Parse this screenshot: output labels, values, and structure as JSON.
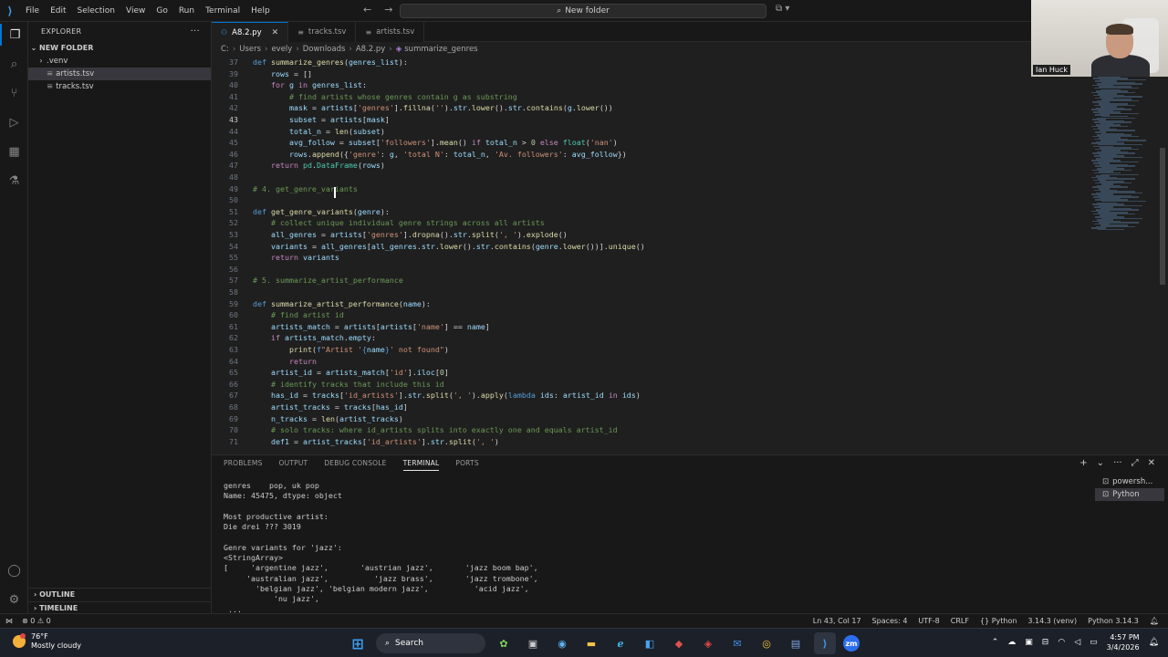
{
  "titlebar": {
    "menu": [
      "File",
      "Edit",
      "Selection",
      "View",
      "Go",
      "Run",
      "Terminal",
      "Help"
    ],
    "command_center": "New folder"
  },
  "sidebar": {
    "title": "EXPLORER",
    "folder": "NEW FOLDER",
    "items": [
      ".venv",
      "artists.tsv",
      "tracks.tsv"
    ],
    "outline": "OUTLINE",
    "timeline": "TIMELINE"
  },
  "tabs": [
    {
      "label": "A8.2.py",
      "active": true
    },
    {
      "label": "tracks.tsv",
      "active": false
    },
    {
      "label": "artists.tsv",
      "active": false
    }
  ],
  "breadcrumb": [
    "C:",
    "Users",
    "evely",
    "Downloads",
    "A8.2.py",
    "summarize_genres"
  ],
  "webcam": {
    "name": "Ian Huck"
  },
  "code_lines": [
    {
      "n": "37",
      "html": "<span class='bl'>def</span> <span class='fn'>summarize_genres</span><span class='pl'>(</span><span class='vr'>genres_list</span><span class='pl'>):</span>"
    },
    {
      "n": "39",
      "html": "    <span class='vr'>rows</span> <span class='pl'>= []</span>"
    },
    {
      "n": "40",
      "html": "    <span class='kw'>for</span> <span class='vr'>g</span> <span class='kw'>in</span> <span class='vr'>genres_list</span><span class='pl'>:</span>"
    },
    {
      "n": "41",
      "html": "        <span class='cm'># find artists whose genres contain g as substring</span>"
    },
    {
      "n": "42",
      "html": "        <span class='vr'>mask</span> <span class='pl'>=</span> <span class='vr'>artists</span><span class='pl'>[</span><span class='st'>'genres'</span><span class='pl'>].</span><span class='fn'>fillna</span><span class='pl'>(</span><span class='st'>''</span><span class='pl'>).</span><span class='vr'>str</span><span class='pl'>.</span><span class='fn'>lower</span><span class='pl'>().</span><span class='vr'>str</span><span class='pl'>.</span><span class='fn'>contains</span><span class='pl'>(</span><span class='vr'>g</span><span class='pl'>.</span><span class='fn'>lower</span><span class='pl'>())</span>"
    },
    {
      "n": "43",
      "html": "        <span class='vr'>subset</span> <span class='pl'>= </span><span class='vr'>artists</span><span class='pl'>[</span><span class='vr'>mask</span><span class='pl'>]</span>",
      "cur": true
    },
    {
      "n": "44",
      "html": "        <span class='vr'>total_n</span> <span class='pl'>=</span> <span class='fn'>len</span><span class='pl'>(</span><span class='vr'>subset</span><span class='pl'>)</span>"
    },
    {
      "n": "45",
      "html": "        <span class='vr'>avg_follow</span> <span class='pl'>=</span> <span class='vr'>subset</span><span class='pl'>[</span><span class='st'>'followers'</span><span class='pl'>].</span><span class='fn'>mean</span><span class='pl'>()</span> <span class='kw'>if</span> <span class='vr'>total_n</span> <span class='pl'>&gt;</span> <span class='nm'>0</span> <span class='kw'>else</span> <span class='ty'>float</span><span class='pl'>(</span><span class='st'>'nan'</span><span class='pl'>)</span>"
    },
    {
      "n": "46",
      "html": "        <span class='vr'>rows</span><span class='pl'>.</span><span class='fn'>append</span><span class='pl'>({</span><span class='st'>'genre'</span><span class='pl'>:</span> <span class='vr'>g</span><span class='pl'>,</span> <span class='st'>'total N'</span><span class='pl'>:</span> <span class='vr'>total_n</span><span class='pl'>,</span> <span class='st'>'Av. followers'</span><span class='pl'>:</span> <span class='vr'>avg_follow</span><span class='pl'>})</span>"
    },
    {
      "n": "47",
      "html": "    <span class='kw'>return</span> <span class='ty'>pd</span><span class='pl'>.</span><span class='ty'>DataFrame</span><span class='pl'>(</span><span class='vr'>rows</span><span class='pl'>)</span>"
    },
    {
      "n": "48",
      "html": ""
    },
    {
      "n": "49",
      "html": "<span class='cm'># 4. get_genre_variants</span>"
    },
    {
      "n": "50",
      "html": ""
    },
    {
      "n": "51",
      "html": "<span class='bl'>def</span> <span class='fn'>get_genre_variants</span><span class='pl'>(</span><span class='vr'>genre</span><span class='pl'>):</span>"
    },
    {
      "n": "52",
      "html": "    <span class='cm'># collect unique individual genre strings across all artists</span>"
    },
    {
      "n": "53",
      "html": "    <span class='vr'>all_genres</span> <span class='pl'>=</span> <span class='vr'>artists</span><span class='pl'>[</span><span class='st'>'genres'</span><span class='pl'>].</span><span class='fn'>dropna</span><span class='pl'>().</span><span class='vr'>str</span><span class='pl'>.</span><span class='fn'>split</span><span class='pl'>(</span><span class='st'>', '</span><span class='pl'>).</span><span class='fn'>explode</span><span class='pl'>()</span>"
    },
    {
      "n": "54",
      "html": "    <span class='vr'>variants</span> <span class='pl'>=</span> <span class='vr'>all_genres</span><span class='pl'>[</span><span class='vr'>all_genres</span><span class='pl'>.</span><span class='vr'>str</span><span class='pl'>.</span><span class='fn'>lower</span><span class='pl'>().</span><span class='vr'>str</span><span class='pl'>.</span><span class='fn'>contains</span><span class='pl'>(</span><span class='vr'>genre</span><span class='pl'>.</span><span class='fn'>lower</span><span class='pl'>())].</span><span class='fn'>unique</span><span class='pl'>()</span>"
    },
    {
      "n": "55",
      "html": "    <span class='kw'>return</span> <span class='vr'>variants</span>"
    },
    {
      "n": "56",
      "html": ""
    },
    {
      "n": "57",
      "html": "<span class='cm'># 5. summarize_artist_performance</span>"
    },
    {
      "n": "58",
      "html": ""
    },
    {
      "n": "59",
      "html": "<span class='bl'>def</span> <span class='fn'>summarize_artist_performance</span><span class='pl'>(</span><span class='vr'>name</span><span class='pl'>):</span>"
    },
    {
      "n": "60",
      "html": "    <span class='cm'># find artist id</span>"
    },
    {
      "n": "61",
      "html": "    <span class='vr'>artists_match</span> <span class='pl'>=</span> <span class='vr'>artists</span><span class='pl'>[</span><span class='vr'>artists</span><span class='pl'>[</span><span class='st'>'name'</span><span class='pl'>]</span> <span class='pl'>==</span> <span class='vr'>name</span><span class='pl'>]</span>"
    },
    {
      "n": "62",
      "html": "    <span class='kw'>if</span> <span class='vr'>artists_match</span><span class='pl'>.</span><span class='vr'>empty</span><span class='pl'>:</span>"
    },
    {
      "n": "63",
      "html": "        <span class='fn'>print</span><span class='pl'>(</span><span class='bl'>f</span><span class='st'>\"Artist '</span><span class='bl'>{</span><span class='vr'>name</span><span class='bl'>}</span><span class='st'>' not found\"</span><span class='pl'>)</span>"
    },
    {
      "n": "64",
      "html": "        <span class='kw'>return</span>"
    },
    {
      "n": "65",
      "html": "    <span class='vr'>artist_id</span> <span class='pl'>=</span> <span class='vr'>artists_match</span><span class='pl'>[</span><span class='st'>'id'</span><span class='pl'>].</span><span class='vr'>iloc</span><span class='pl'>[</span><span class='nm'>0</span><span class='pl'>]</span>"
    },
    {
      "n": "66",
      "html": "    <span class='cm'># identify tracks that include this id</span>"
    },
    {
      "n": "67",
      "html": "    <span class='vr'>has_id</span> <span class='pl'>=</span> <span class='vr'>tracks</span><span class='pl'>[</span><span class='st'>'id_artists'</span><span class='pl'>].</span><span class='vr'>str</span><span class='pl'>.</span><span class='fn'>split</span><span class='pl'>(</span><span class='st'>', '</span><span class='pl'>).</span><span class='fn'>apply</span><span class='pl'>(</span><span class='bl'>lambda</span> <span class='vr'>ids</span><span class='pl'>:</span> <span class='vr'>artist_id</span> <span class='kw'>in</span> <span class='vr'>ids</span><span class='pl'>)</span>"
    },
    {
      "n": "68",
      "html": "    <span class='vr'>artist_tracks</span> <span class='pl'>=</span> <span class='vr'>tracks</span><span class='pl'>[</span><span class='vr'>has_id</span><span class='pl'>]</span>"
    },
    {
      "n": "69",
      "html": "    <span class='vr'>n_tracks</span> <span class='pl'>=</span> <span class='fn'>len</span><span class='pl'>(</span><span class='vr'>artist_tracks</span><span class='pl'>)</span>"
    },
    {
      "n": "70",
      "html": "    <span class='cm'># solo tracks: where id_artists splits into exactly one and equals artist_id</span>"
    },
    {
      "n": "71",
      "html": "    <span class='vr'>def1</span> <span class='pl'>=</span> <span class='vr'>artist_tracks</span><span class='pl'>[</span><span class='st'>'id_artists'</span><span class='pl'>].</span><span class='vr'>str</span><span class='pl'>.</span><span class='fn'>split</span><span class='pl'>(</span><span class='st'>', '</span><span class='pl'>)</span>"
    }
  ],
  "panel": {
    "tabs": [
      "PROBLEMS",
      "OUTPUT",
      "DEBUG CONSOLE",
      "TERMINAL",
      "PORTS"
    ],
    "active_tab": "TERMINAL",
    "terminal_lines": [
      "genres    pop, uk pop",
      "Name: 45475, dtype: object",
      "",
      "Most productive artist:",
      "Die drei ??? 3019",
      "",
      "Genre variants for 'jazz':",
      "<StringArray>",
      "[     'argentine jazz',       'austrian jazz',       'jazz boom bap',",
      "     'australian jazz',          'jazz brass',       'jazz trombone',",
      "       'belgian jazz', 'belgian modern jazz',          'acid jazz',",
      "           'nu jazz',",
      " ..."
    ],
    "terminal_list": [
      "powersh...",
      "Python"
    ]
  },
  "statusbar": {
    "errors": "0",
    "warnings": "0",
    "position": "Ln 43, Col 17",
    "spaces": "Spaces: 4",
    "encoding": "UTF-8",
    "eol": "CRLF",
    "language": "Python",
    "interpreter": "3.14.3 (venv)",
    "python_version": "Python 3.14.3"
  },
  "taskbar": {
    "temp": "76°F",
    "weather": "Mostly cloudy",
    "search": "Search",
    "time": "4:57 PM",
    "date": "3/4/2026"
  }
}
